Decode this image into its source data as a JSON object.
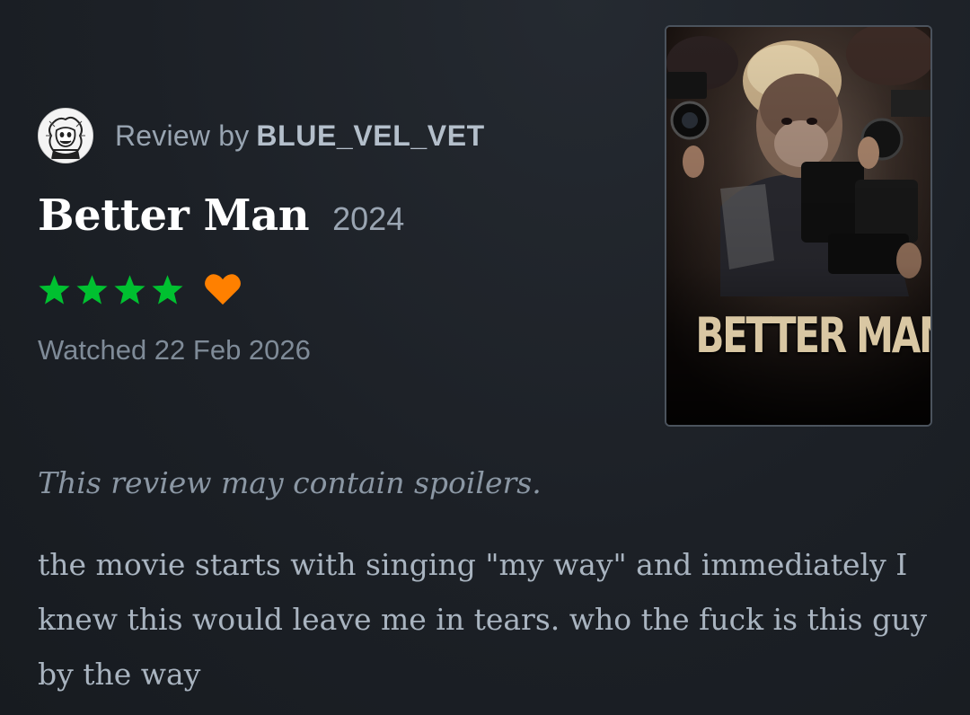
{
  "review": {
    "by_prefix": "Review by",
    "username": "BLUE_VEL_VET",
    "avatar_icon": "cartoon-character-avatar"
  },
  "film": {
    "title": "Better Man",
    "year": "2024",
    "poster_title": "BETTER MAN"
  },
  "rating": {
    "stars": 4,
    "max_stars": 5,
    "liked": true,
    "star_color": "#00c030",
    "heart_color": "#ff8000"
  },
  "watched": "Watched 22 Feb 2026",
  "spoiler_notice": "This review may contain spoilers.",
  "body": "the movie starts with singing \"my way\" and immediately I knew this would leave me in tears. who the fuck is this guy by the way"
}
